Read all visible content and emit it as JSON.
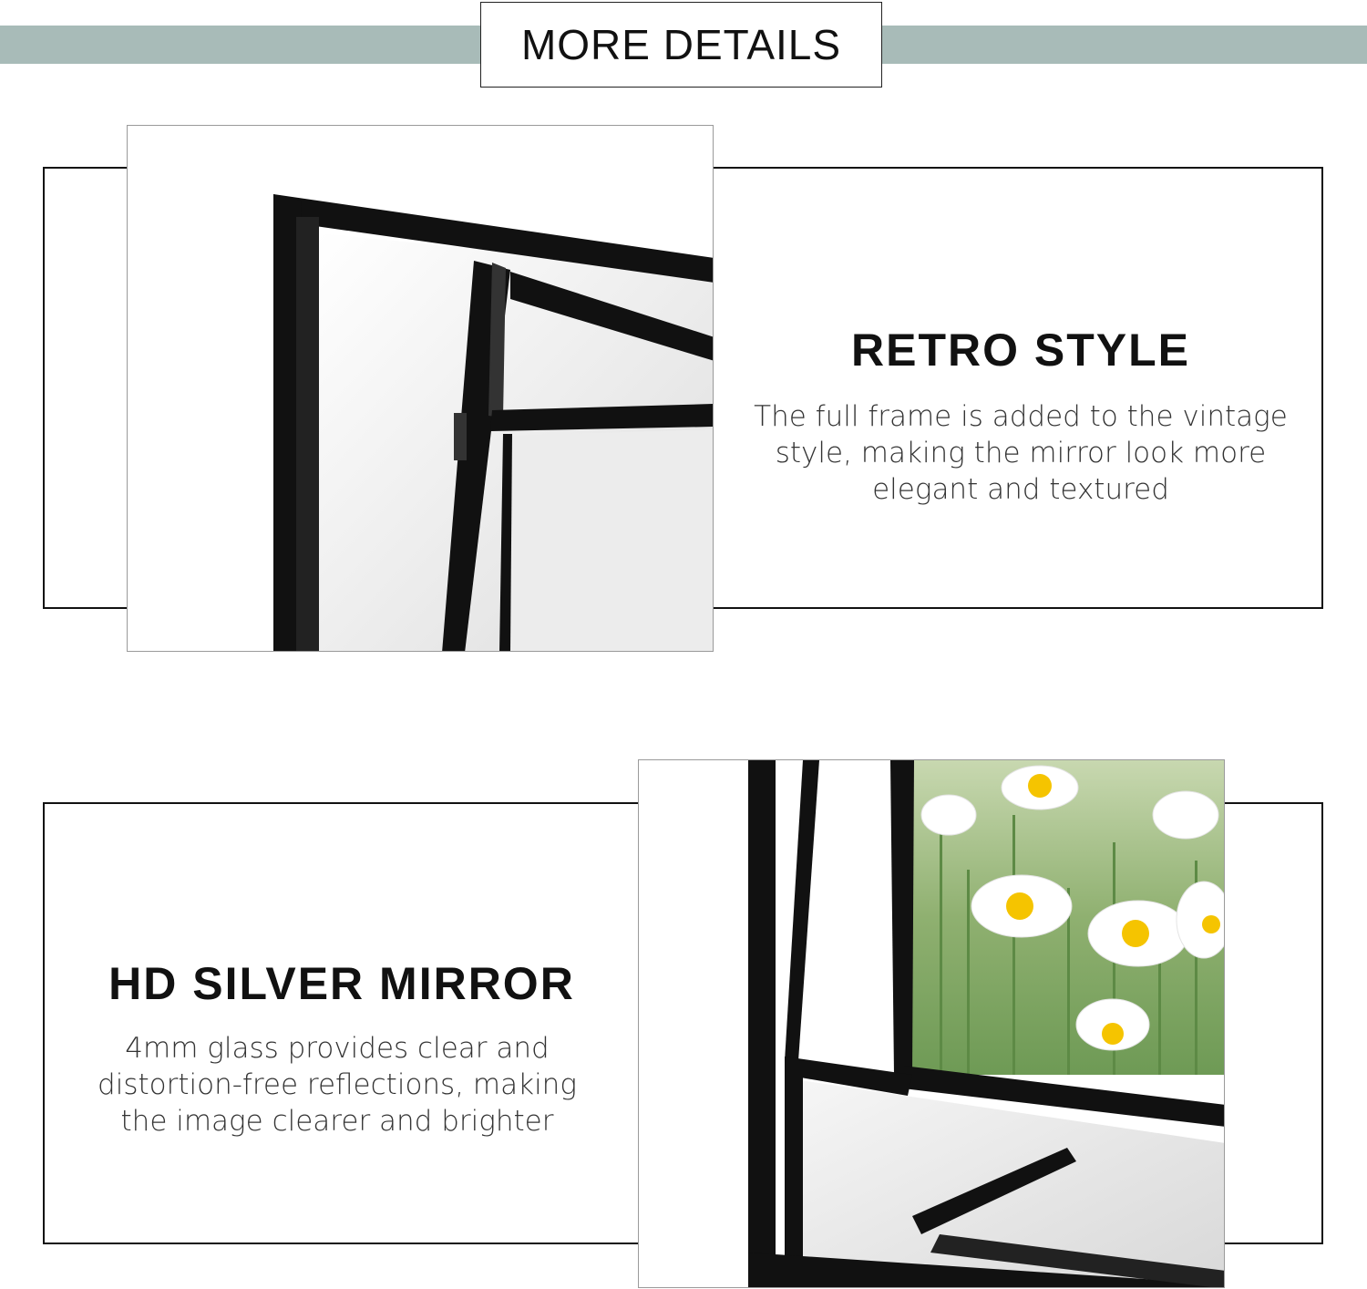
{
  "header": {
    "title": "MORE DETAILS"
  },
  "features": [
    {
      "title": "RETRO STYLE",
      "description": "The full frame is added to the vintage style, making the mirror look more elegant and textured",
      "image": "black-metal-frame-corner-closeup"
    },
    {
      "title": "HD SILVER MIRROR",
      "description": "4mm glass provides clear and distortion-free reflections, making the image clearer and brighter",
      "image": "mirror-frame-reflecting-daisies-closeup"
    }
  ],
  "colors": {
    "band": "#a8bbb8",
    "text": "#111111",
    "frame": "#111111"
  }
}
